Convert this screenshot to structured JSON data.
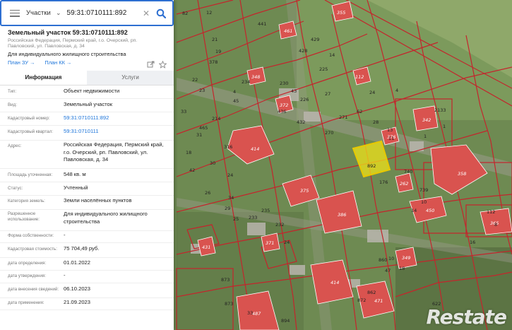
{
  "search": {
    "type_label": "Участки",
    "query": "59:31:0710111:892"
  },
  "object": {
    "title": "Земельный участок 59:31:0710111:892",
    "address_short": "Российская Федерация, Пермский край, г.о. Очерский, рп. Павловский, ул. Павловская, д. 34",
    "usage": "Для индивидуального жилищного строительства",
    "plan_zu": "План ЗУ →",
    "plan_kk": "План КК →"
  },
  "tabs": [
    "Информация",
    "Услуги"
  ],
  "info_rows": [
    {
      "key": "Тип:",
      "value": "Объект недвижимости"
    },
    {
      "key": "Вид:",
      "value": "Земельный участок"
    },
    {
      "key": "Кадастровый номер:",
      "value": "59:31:0710111:892"
    },
    {
      "key": "Кадастровый квартал:",
      "value": "59:31:0710111"
    },
    {
      "key": "Адрес:",
      "value": "Российская Федерация, Пермский край, г.о. Очерский, рп. Павловский, ул. Павловская, д. 34"
    },
    {
      "key": "Площадь уточненная:",
      "value": "548 кв. м"
    },
    {
      "key": "Статус:",
      "value": "Учтенный"
    },
    {
      "key": "Категория земель:",
      "value": "Земли населённых пунктов"
    },
    {
      "key": "Разрешенное использование:",
      "value": "Для индивидуального жилищного строительства"
    },
    {
      "key": "Форма собственности:",
      "value": "-"
    },
    {
      "key": "Кадастровая стоимость:",
      "value": "75 704,49 руб."
    },
    {
      "key": "дата определения:",
      "value": "01.01.2022"
    },
    {
      "key": "дата утверждения:",
      "value": "-"
    },
    {
      "key": "дата внесения сведений:",
      "value": "06.10.2023"
    },
    {
      "key": "дата применения:",
      "value": "21.09.2023"
    }
  ],
  "map_labels": {
    "plots": [
      "82",
      "12",
      "441",
      "21",
      "19",
      "378",
      "429",
      "14",
      "428",
      "225",
      "22",
      "23",
      "4",
      "24",
      "4",
      "45",
      "234",
      "230",
      "43",
      "432",
      "62",
      "436",
      "226",
      "33",
      "214",
      "27",
      "271",
      "28",
      "13",
      "2133",
      "1",
      "11",
      "1",
      "31",
      "465",
      "270",
      "176",
      "740",
      "739",
      "10",
      "316",
      "18",
      "42",
      "30",
      "24",
      "26",
      "34",
      "29",
      "25",
      "233",
      "232",
      "235",
      "24",
      "860",
      "10",
      "18",
      "47",
      "872",
      "14",
      "112",
      "873",
      "873",
      "33",
      "894",
      "862",
      "622",
      "16",
      "8"
    ],
    "buildings": [
      "414",
      "375",
      "386",
      "358",
      "450",
      "414",
      "471",
      "487",
      "342",
      "376",
      "262",
      "349",
      "431",
      "371",
      "461",
      "348",
      "372",
      "112",
      "355",
      "365"
    ],
    "selected": "892"
  },
  "watermark": "Restate",
  "colors": {
    "accent": "#2d6fd1",
    "link": "#1a73d9",
    "boundary": "#c4252c",
    "selected_fill": "#f0e11a"
  }
}
